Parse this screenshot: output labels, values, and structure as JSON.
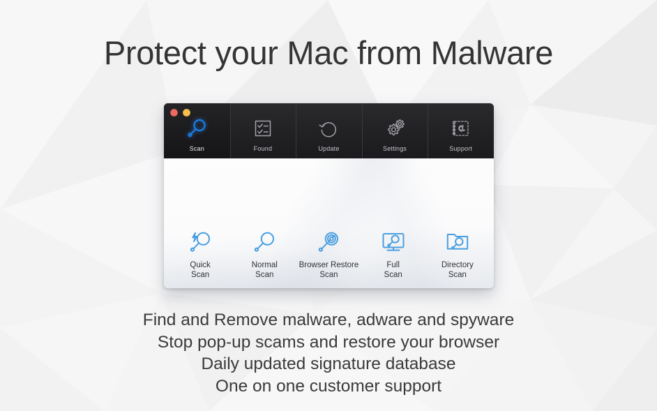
{
  "headline": "Protect your Mac from Malware",
  "colors": {
    "accent_blue": "#4a9fe0",
    "active_tab_icon": "#1b7fe8",
    "titlebar_bg": "#1e1e20",
    "tab_label": "#c6c6ca",
    "headline_text": "#343434",
    "feature_text": "#3a3a3a",
    "traffic_red": "#ec6a5f",
    "traffic_yellow": "#f5bf4f"
  },
  "window": {
    "traffic_lights": [
      {
        "name": "close",
        "color": "#ec6a5f"
      },
      {
        "name": "minimize",
        "color": "#f5bf4f"
      }
    ],
    "toolbar": {
      "tabs": [
        {
          "id": "scan",
          "label": "Scan",
          "icon": "magnifier-icon",
          "active": true
        },
        {
          "id": "found",
          "label": "Found",
          "icon": "checklist-icon",
          "active": false
        },
        {
          "id": "update",
          "label": "Update",
          "icon": "refresh-arrow-icon",
          "active": false
        },
        {
          "id": "settings",
          "label": "Settings",
          "icon": "gears-icon",
          "active": false
        },
        {
          "id": "support",
          "label": "Support",
          "icon": "at-sign-stamp-icon",
          "active": false
        }
      ]
    },
    "scan_options": [
      {
        "id": "quick",
        "label_line1": "Quick",
        "label_line2": "Scan",
        "icon": "bolt-magnifier-icon"
      },
      {
        "id": "normal",
        "label_line1": "Normal",
        "label_line2": "Scan",
        "icon": "magnifier-icon"
      },
      {
        "id": "browser",
        "label_line1": "Browser Restore",
        "label_line2": "Scan",
        "icon": "globe-magnifier-icon"
      },
      {
        "id": "full",
        "label_line1": "Full",
        "label_line2": "Scan",
        "icon": "monitor-magnifier-icon"
      },
      {
        "id": "directory",
        "label_line1": "Directory",
        "label_line2": "Scan",
        "icon": "folder-magnifier-icon"
      }
    ]
  },
  "features": [
    "Find and Remove malware, adware and spyware",
    "Stop pop-up scams and restore your browser",
    "Daily updated signature database",
    "One on one customer support"
  ]
}
